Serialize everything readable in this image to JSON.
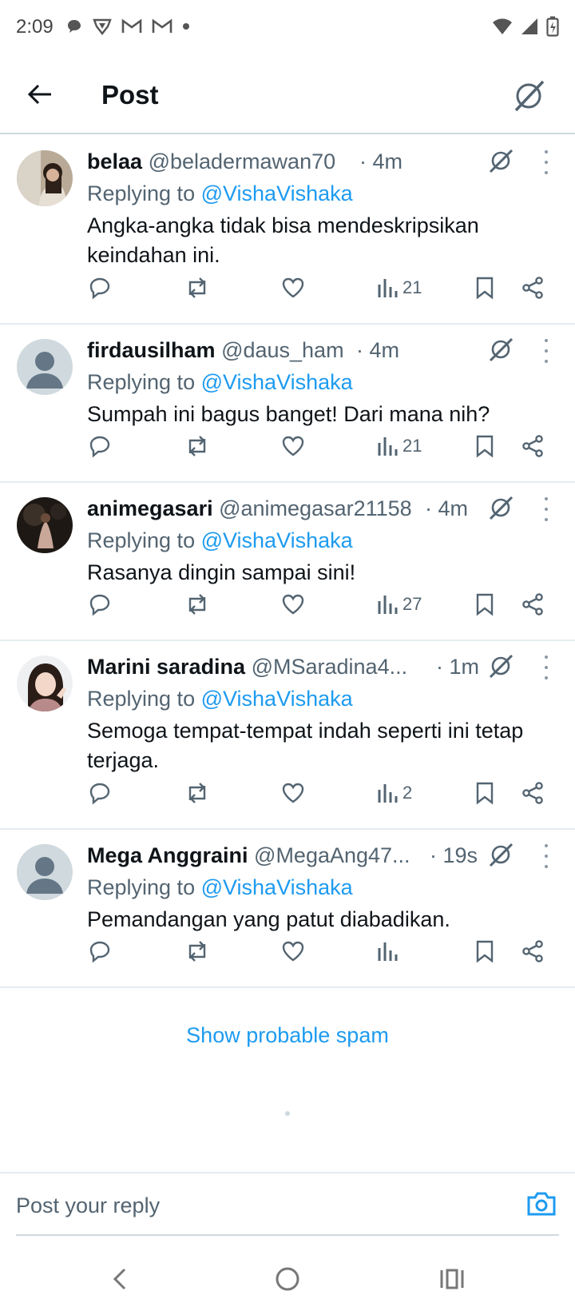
{
  "status_bar": {
    "time": "2:09",
    "left_icons": [
      "chat-bubble-icon",
      "vpn-shield-icon",
      "gmail-icon",
      "gmail-icon",
      "dot-icon"
    ],
    "right_icons": [
      "wifi-icon",
      "signal-icon",
      "battery-icon"
    ]
  },
  "header": {
    "title": "Post",
    "back_icon": "arrow-left-icon",
    "grok_icon": "grok-icon"
  },
  "replies": [
    {
      "name": "belaa",
      "handle": "@beladermawan70",
      "time": "· 4m",
      "replying_prefix": "Replying to",
      "replying_to": "@VishaVishaka",
      "text": "Angka-angka tidak bisa mendeskripsikan keindahan ini.",
      "views": "21",
      "avatar": "photo"
    },
    {
      "name": "firdausilham",
      "handle": "@daus_ham",
      "time": "· 4m",
      "replying_prefix": "Replying to",
      "replying_to": "@VishaVishaka",
      "text": "Sumpah ini bagus banget! Dari mana nih?",
      "views": "21",
      "avatar": "default"
    },
    {
      "name": "animegasari",
      "handle": "@animegasar21158",
      "time": "· 4m",
      "replying_prefix": "Replying to",
      "replying_to": "@VishaVishaka",
      "text": "Rasanya dingin sampai sini!",
      "views": "27",
      "avatar": "photo-dark"
    },
    {
      "name": "Marini saradina",
      "handle": "@MSaradina4...",
      "time": "· 1m",
      "replying_prefix": "Replying to",
      "replying_to": "@VishaVishaka",
      "text": "Semoga tempat-tempat indah seperti ini tetap terjaga.",
      "views": "2",
      "avatar": "photo-light"
    },
    {
      "name": "Mega Anggraini",
      "handle": "@MegaAng47...",
      "time": "· 19s",
      "replying_prefix": "Replying to",
      "replying_to": "@VishaVishaka",
      "text": "Pemandangan yang patut diabadikan.",
      "views": "",
      "avatar": "default"
    }
  ],
  "show_spam": "Show probable spam",
  "compose": {
    "placeholder": "Post your reply",
    "camera_icon": "camera-icon"
  },
  "nav": {
    "back": "nav-back-icon",
    "home": "nav-home-icon",
    "recents": "nav-recents-icon"
  },
  "colors": {
    "accent": "#1d9bf0",
    "text_primary": "#0f1419",
    "text_secondary": "#536471",
    "divider": "#e6ecf0"
  }
}
